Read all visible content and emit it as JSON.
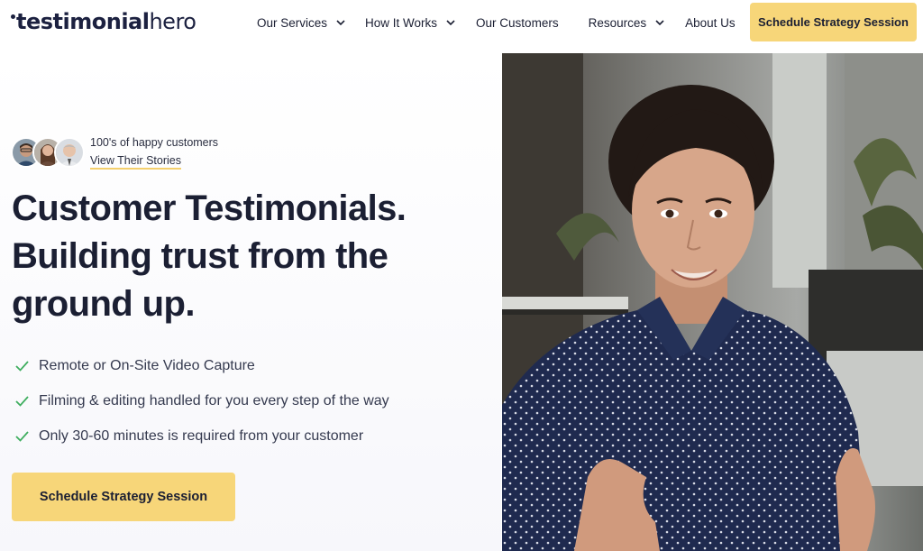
{
  "brand": {
    "logo_part1": "testimonial",
    "logo_part2": "hero"
  },
  "nav": {
    "items": [
      {
        "label": "Our Services",
        "has_dropdown": true
      },
      {
        "label": "How It Works",
        "has_dropdown": true
      },
      {
        "label": "Our Customers",
        "has_dropdown": false
      },
      {
        "label": "Resources",
        "has_dropdown": true
      },
      {
        "label": "About Us",
        "has_dropdown": false
      }
    ],
    "cta_label": "Schedule Strategy Session"
  },
  "social_proof": {
    "happy_text": "100's of happy customers",
    "link_text": "View Their Stories"
  },
  "hero": {
    "headline_line1": "Customer Testimonials.",
    "headline_line2": "Building trust from the",
    "headline_line3": "ground up.",
    "features": [
      "Remote or On-Site Video Capture",
      "Filming & editing handled for you every step of the way",
      "Only 30-60 minutes is required from your customer"
    ],
    "cta_label": "Schedule Strategy Session"
  },
  "colors": {
    "accent_yellow": "#f7d679",
    "check_green": "#3fae5f",
    "text_dark": "#1b1f33"
  }
}
